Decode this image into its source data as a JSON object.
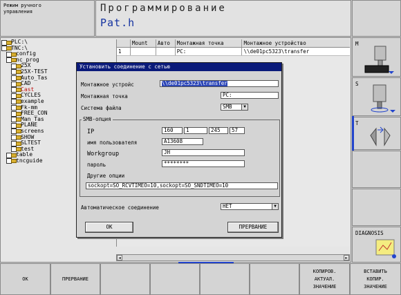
{
  "header": {
    "mode_line1": "Режим ручного",
    "mode_line2": "управления",
    "title": "Программирование",
    "file": "Pat.h"
  },
  "tree": [
    {
      "label": "PLC:\\",
      "indent": 0
    },
    {
      "label": "TNC:\\",
      "indent": 0
    },
    {
      "label": "config",
      "indent": 1
    },
    {
      "label": "nc_prog",
      "indent": 1
    },
    {
      "label": "25X",
      "indent": 2
    },
    {
      "label": "25X-TEST",
      "indent": 2
    },
    {
      "label": "Auto_Tas",
      "indent": 2
    },
    {
      "label": "CAD",
      "indent": 2
    },
    {
      "label": "Cast",
      "indent": 2,
      "selected": true
    },
    {
      "label": "CYCLES",
      "indent": 2
    },
    {
      "label": "example",
      "indent": 2
    },
    {
      "label": "Fk-mm",
      "indent": 2
    },
    {
      "label": "FREE_CON",
      "indent": 2
    },
    {
      "label": "Man_Tas",
      "indent": 2
    },
    {
      "label": "PLANE",
      "indent": 2
    },
    {
      "label": "screens",
      "indent": 2
    },
    {
      "label": "SHOW",
      "indent": 2
    },
    {
      "label": "SLTEST",
      "indent": 2
    },
    {
      "label": "test",
      "indent": 2
    },
    {
      "label": "table",
      "indent": 1
    },
    {
      "label": "tncguide",
      "indent": 1
    }
  ],
  "grid": {
    "headers": [
      "",
      "Mount",
      "Авто",
      "Монтажная точка",
      "Монтажное устройство"
    ],
    "rows": [
      [
        "1",
        "",
        "",
        "PC:",
        "\\\\de01pc5323\\transfer"
      ]
    ]
  },
  "dialog": {
    "title": "Установить соединение с сетью",
    "mount_device_label": "Монтажное устройс",
    "mount_device_value": "\\\\de01pc5323\\transfer",
    "mount_point_label": "Монтажная точка",
    "mount_point_value": "PC:",
    "fs_label": "Система файла",
    "fs_value": "SMB",
    "group_label": "SMB-опция",
    "ip_label": "IP",
    "ip": [
      "160",
      "1",
      "245",
      "57"
    ],
    "user_label": "имя пользователя",
    "user_value": "A13608",
    "workgroup_label": "Workgroup",
    "workgroup_value": "JH",
    "password_label": "пароль",
    "password_value": "********",
    "other_label": "Другие опции",
    "other_value": "sockopt=SO_RCVTIMEO=10,sockopt=SO_SNDTIMEO=10",
    "auto_label": "Автоматическое соединение",
    "auto_value": "НЕТ",
    "ok_label": "OK",
    "cancel_label": "ПРЕРВАНИЕ"
  },
  "right_keys": {
    "m_label": "M",
    "s_label": "S",
    "t_label": "T",
    "diag_label": "DIAGNOSIS"
  },
  "bottom_keys": [
    {
      "label": "OK"
    },
    {
      "label": "ПРЕРВАНИЕ"
    },
    {
      "label": ""
    },
    {
      "label": ""
    },
    {
      "label": ""
    },
    {
      "label": ""
    },
    {
      "label": "КОПИРОВ. АКТУАЛ. ЗНАЧЕНИЕ"
    },
    {
      "label": "ВСТАВИТЬ КОПИР. ЗНАЧЕНИЕ"
    }
  ],
  "colors": {
    "title_bar": "#0a1a7a",
    "file_name": "#1432a0",
    "highlight": "#2c46b8",
    "accent": "#2244cc"
  }
}
